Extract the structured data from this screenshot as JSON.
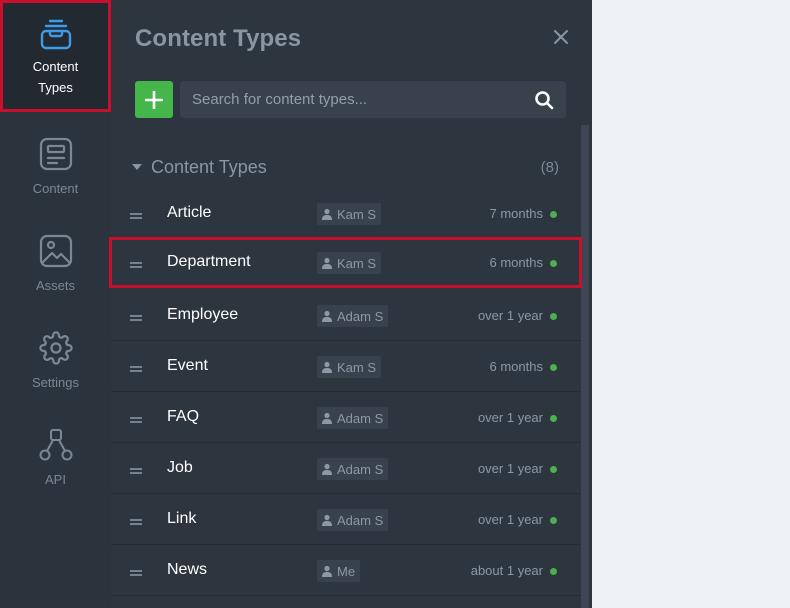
{
  "rail": {
    "items": [
      {
        "label": "Content\nTypes",
        "icon": "content-types-icon"
      },
      {
        "label": "Content",
        "icon": "content-icon"
      },
      {
        "label": "Assets",
        "icon": "assets-icon"
      },
      {
        "label": "Settings",
        "icon": "gear-icon"
      },
      {
        "label": "API",
        "icon": "api-icon"
      }
    ]
  },
  "panel": {
    "title": "Content Types",
    "search_placeholder": "Search for content types...",
    "group": {
      "title": "Content Types",
      "count": "(8)"
    },
    "rows": [
      {
        "name": "Article",
        "author": "Kam S",
        "time": "7 months"
      },
      {
        "name": "Department",
        "author": "Kam S",
        "time": "6 months"
      },
      {
        "name": "Employee",
        "author": "Adam S",
        "time": "over 1 year"
      },
      {
        "name": "Event",
        "author": "Kam S",
        "time": "6 months"
      },
      {
        "name": "FAQ",
        "author": "Adam S",
        "time": "over 1 year"
      },
      {
        "name": "Job",
        "author": "Adam S",
        "time": "over 1 year"
      },
      {
        "name": "Link",
        "author": "Adam S",
        "time": "over 1 year"
      },
      {
        "name": "News",
        "author": "Me",
        "time": "about 1 year"
      }
    ]
  },
  "colors": {
    "accent_green": "#45b649",
    "status_dot": "#4caf50",
    "highlight_border": "#c8102e",
    "active_icon": "#3d9be9"
  }
}
